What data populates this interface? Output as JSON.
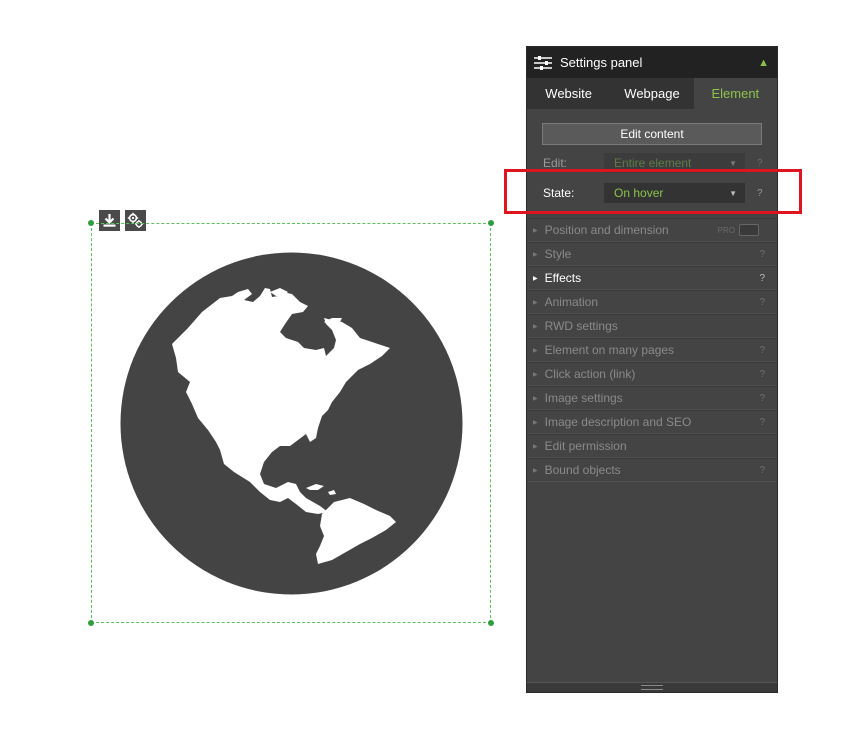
{
  "panel": {
    "title": "Settings panel",
    "collapse_icon": "chevron-up-icon",
    "tabs": [
      {
        "label": "Website"
      },
      {
        "label": "Webpage"
      },
      {
        "label": "Element"
      }
    ],
    "active_tab": "Element",
    "edit_content_label": "Edit content",
    "edit": {
      "label": "Edit:",
      "value": "Entire element",
      "help": "?"
    },
    "state": {
      "label": "State:",
      "value": "On hover",
      "help": "?"
    },
    "sections": [
      {
        "label": "Position and dimension",
        "badge": "PRO"
      },
      {
        "label": "Style",
        "help": "?"
      },
      {
        "label": "Effects",
        "help": "?"
      },
      {
        "label": "Animation",
        "help": "?"
      },
      {
        "label": "RWD settings"
      },
      {
        "label": "Element on many pages",
        "help": "?"
      },
      {
        "label": "Click action (link)",
        "help": "?"
      },
      {
        "label": "Image settings",
        "help": "?"
      },
      {
        "label": "Image description and SEO",
        "help": "?"
      },
      {
        "label": "Edit permission"
      },
      {
        "label": "Bound objects",
        "help": "?"
      }
    ],
    "enabled_section": "Effects"
  },
  "canvas": {
    "element_icon": "globe-icon",
    "toolbar_icons": [
      "download-icon",
      "gears-icon"
    ]
  },
  "colors": {
    "accent": "#8bc34a",
    "highlight": "#e0141e",
    "panel_bg": "#444444",
    "header_bg": "#222222",
    "globe": "#444444",
    "selection": "#5bbf5b"
  }
}
